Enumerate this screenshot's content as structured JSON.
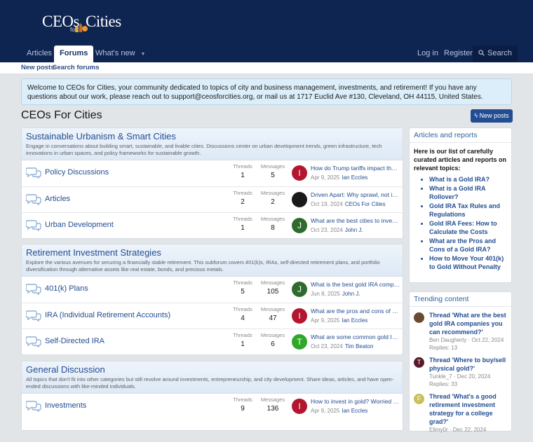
{
  "brand": {
    "part1": "CEOs",
    "part2": "for",
    "part3": "Cities"
  },
  "nav": {
    "articles": "Articles",
    "forums": "Forums",
    "whats_new": "What's new",
    "login": "Log in",
    "register": "Register",
    "search": "Search"
  },
  "subnav": {
    "new_posts": "New posts",
    "search_forums": "Search forums"
  },
  "notice": "Welcome to CEOs for Cities, your community dedicated to topics of city and business management, investments, and retirement! If you have any questions about our work, please reach out to support@ceosforcities.org, or mail us at 1717 Euclid Ave #130, Cleveland, OH 44115, United States.",
  "page_title": "CEOs For Cities",
  "new_posts_button": "New posts",
  "stat_labels": {
    "threads": "Threads",
    "messages": "Messages"
  },
  "categories": [
    {
      "title": "Sustainable Urbanism & Smart Cities",
      "description": "Engage in conversations about building smart, sustainable, and livable cities. Discussions center on urban development trends, green infrastructure, tech innovations in urban spaces, and policy frameworks for sustainable growth.",
      "nodes": [
        {
          "title": "Policy Discussions",
          "threads": "1",
          "messages": "5",
          "last_title": "How do Trump tariffs impact the ec...",
          "last_date": "Apr 9, 2025",
          "last_user": "Ian Eccles",
          "avatar_letter": "I",
          "avatar_color": "#b3162f"
        },
        {
          "title": "Articles",
          "threads": "2",
          "messages": "2",
          "last_title": "Driven Apart: Why sprawl, not insu...",
          "last_date": "Oct 19, 2024",
          "last_user": "CEOs For Cities",
          "avatar_letter": "",
          "avatar_color": "#1a1a1a"
        },
        {
          "title": "Urban Development",
          "threads": "1",
          "messages": "8",
          "last_title": "What are the best cities to invest i...",
          "last_date": "Oct 23, 2024",
          "last_user": "John J.",
          "avatar_letter": "J",
          "avatar_color": "#2f6b2c"
        }
      ]
    },
    {
      "title": "Retirement Investment Strategies",
      "description": "Explore the various avenues for securing a financially stable retirement. This subforum covers 401(k)s, IRAs, self-directed retirement plans, and portfolio diversification through alternative assets like real estate, bonds, and precious metals.",
      "nodes": [
        {
          "title": "401(k) Plans",
          "threads": "5",
          "messages": "105",
          "last_title": "What is the best gold IRA compa...",
          "last_date": "Jun 8, 2025",
          "last_user": "John J.",
          "avatar_letter": "J",
          "avatar_color": "#2f6b2c"
        },
        {
          "title": "IRA (Individual Retirement Accounts)",
          "threads": "4",
          "messages": "47",
          "last_title": "What are the pros and cons of gol...",
          "last_date": "Apr 9, 2025",
          "last_user": "Ian Eccles",
          "avatar_letter": "I",
          "avatar_color": "#b3162f"
        },
        {
          "title": "Self-Directed IRA",
          "threads": "1",
          "messages": "6",
          "last_title": "What are some common gold IRA ...",
          "last_date": "Oct 23, 2024",
          "last_user": "Tim Beaton",
          "avatar_letter": "T",
          "avatar_color": "#2fa82a"
        }
      ]
    },
    {
      "title": "General Discussion",
      "description": "All topics that don't fit into other categories but still revolve around investments, entrepreneurship, and city development. Share ideas, articles, and have open-ended discussions with like-minded individuals.",
      "nodes": [
        {
          "title": "Investments",
          "threads": "9",
          "messages": "136",
          "last_title": "How to invest in gold? Worried ab...",
          "last_date": "Apr 9, 2025",
          "last_user": "Ian Eccles",
          "avatar_letter": "I",
          "avatar_color": "#b3162f"
        }
      ]
    }
  ],
  "sidebar": {
    "articles": {
      "title": "Articles and reports",
      "intro": "Here is our list of carefully curated articles and reports on relevant topics:",
      "items": [
        "What is a Gold IRA?",
        "What is a Gold IRA Rollover?",
        "Gold IRA Tax Rules and Regulations",
        "Gold IRA Fees: How to Calculate the Costs",
        "What are the Pros and Cons of a Gold IRA?",
        "How to Move Your 401(k) to Gold Without Penalty"
      ]
    },
    "trending": {
      "title": "Trending content",
      "items": [
        {
          "title": "Thread 'What are the best gold IRA companies you can recommend?'",
          "user": "Ben Daugherty",
          "date": "Oct 22, 2024",
          "replies": "Replies: 13",
          "avatar_letter": "",
          "avatar_color": "#6b4a32"
        },
        {
          "title": "Thread 'Where to buy/sell physical gold?'",
          "user": "Tunkle_7",
          "date": "Dec 20, 2024",
          "replies": "Replies: 33",
          "avatar_letter": "T",
          "avatar_color": "#5a1a2a"
        },
        {
          "title": "Thread 'What's a good retirement investment strategy for a college grad?'",
          "user": "Elimy0r",
          "date": "Dec 22, 2024",
          "replies": "",
          "avatar_letter": "F",
          "avatar_color": "#c9c058"
        }
      ]
    }
  },
  "colors": {
    "header": "#0e2451",
    "link": "#234d92",
    "accent": "#234d92"
  }
}
